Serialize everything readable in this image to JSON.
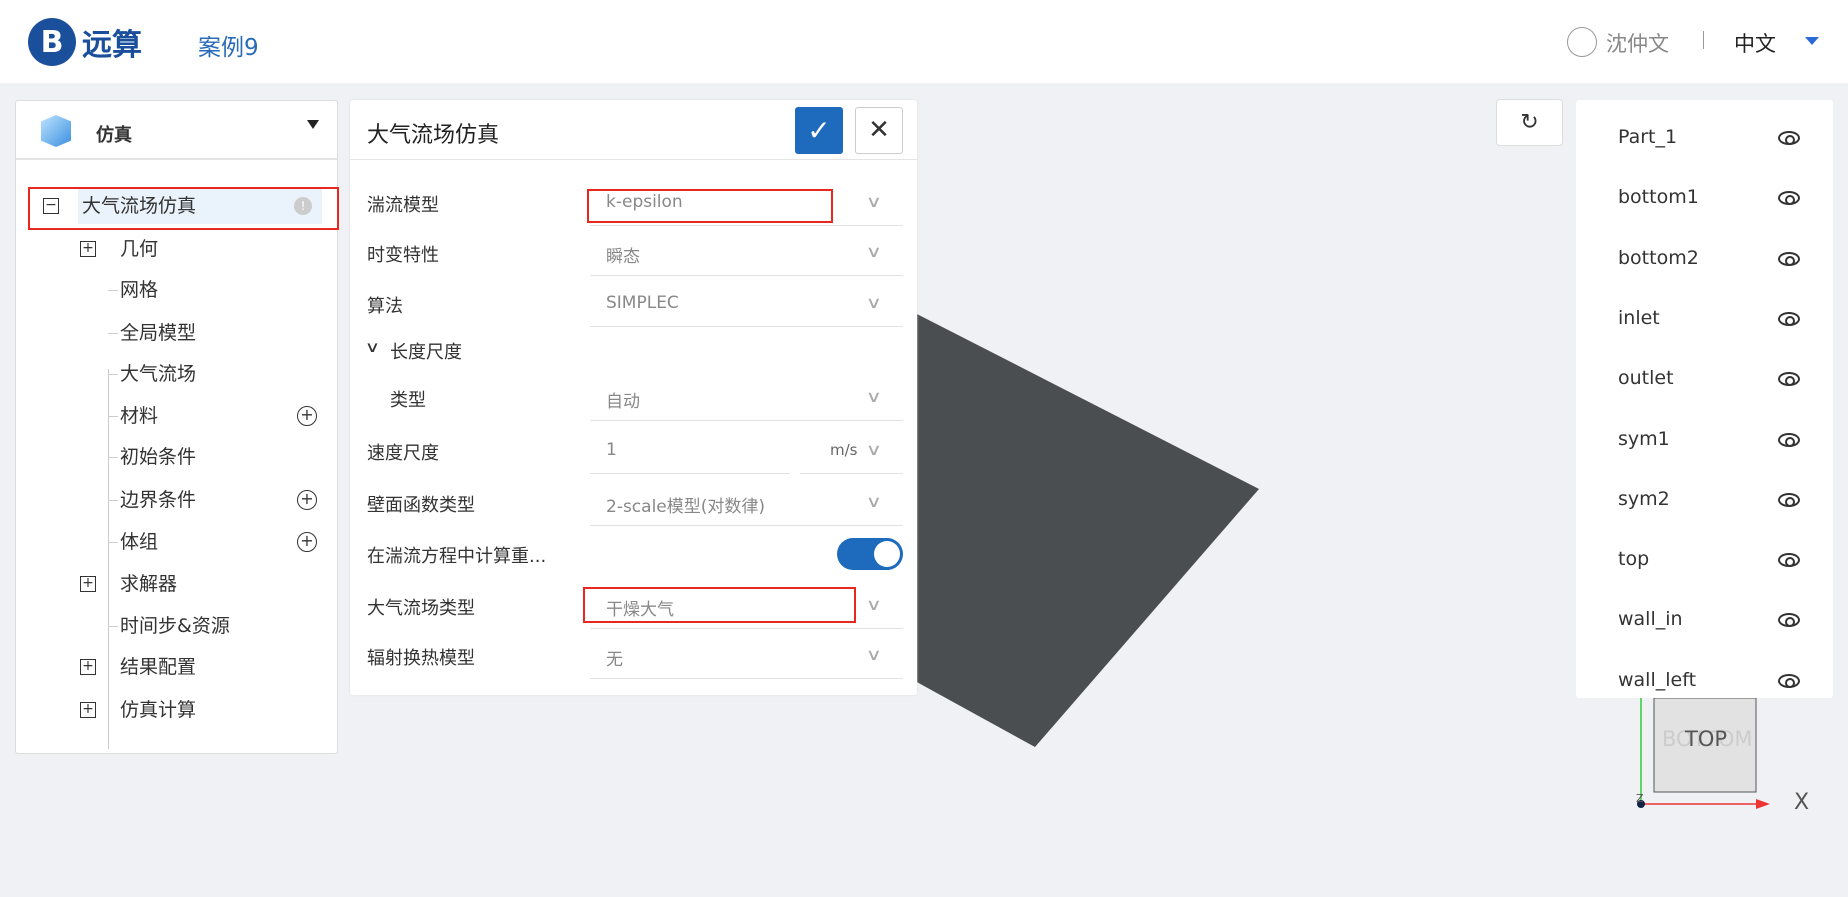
{
  "header": {
    "logo_text": "远算",
    "case_title": "案例9",
    "user_name": "沈仲文",
    "language": "中文"
  },
  "left_panel": {
    "title": "仿真",
    "tree": [
      {
        "label": "大气流场仿真",
        "expander": "minus",
        "badge": "!"
      },
      {
        "label": "几何",
        "expander": "plus"
      },
      {
        "label": "网格"
      },
      {
        "label": "全局模型"
      },
      {
        "label": "大气流场"
      },
      {
        "label": "材料",
        "add": true
      },
      {
        "label": "初始条件"
      },
      {
        "label": "边界条件",
        "add": true
      },
      {
        "label": "体组",
        "add": true
      },
      {
        "label": "求解器",
        "expander": "plus"
      },
      {
        "label": "时间步&资源"
      },
      {
        "label": "结果配置",
        "expander": "plus"
      },
      {
        "label": "仿真计算",
        "expander": "plus"
      }
    ]
  },
  "form": {
    "title": "大气流场仿真",
    "confirm": "✓",
    "close": "✕",
    "rows": [
      {
        "label": "湍流模型",
        "value": "k-epsilon"
      },
      {
        "label": "时变特性",
        "value": "瞬态"
      },
      {
        "label": "算法",
        "value": "SIMPLEC"
      },
      {
        "label": "长度尺度",
        "section": true
      },
      {
        "label": "类型",
        "value": "自动"
      },
      {
        "label": "速度尺度",
        "value": "1",
        "unit": "m/s"
      },
      {
        "label": "壁面函数类型",
        "value": "2-scale模型(对数律)"
      },
      {
        "label": "在湍流方程中计算重...",
        "toggle": true
      },
      {
        "label": "大气流场类型",
        "value": "干燥大气"
      },
      {
        "label": "辐射换热模型",
        "value": "无"
      }
    ]
  },
  "parts": [
    "Part_1",
    "bottom1",
    "bottom2",
    "inlet",
    "outlet",
    "sym1",
    "sym2",
    "top",
    "wall_in",
    "wall_left"
  ],
  "axes": {
    "cube_face": "TOP",
    "cube_face_back": "BOTTOM",
    "x_label": "X",
    "z_label": "Z"
  },
  "colors": {
    "accent": "#1e6bbd",
    "highlight": "#e8281e",
    "model": "#4b4e51"
  }
}
